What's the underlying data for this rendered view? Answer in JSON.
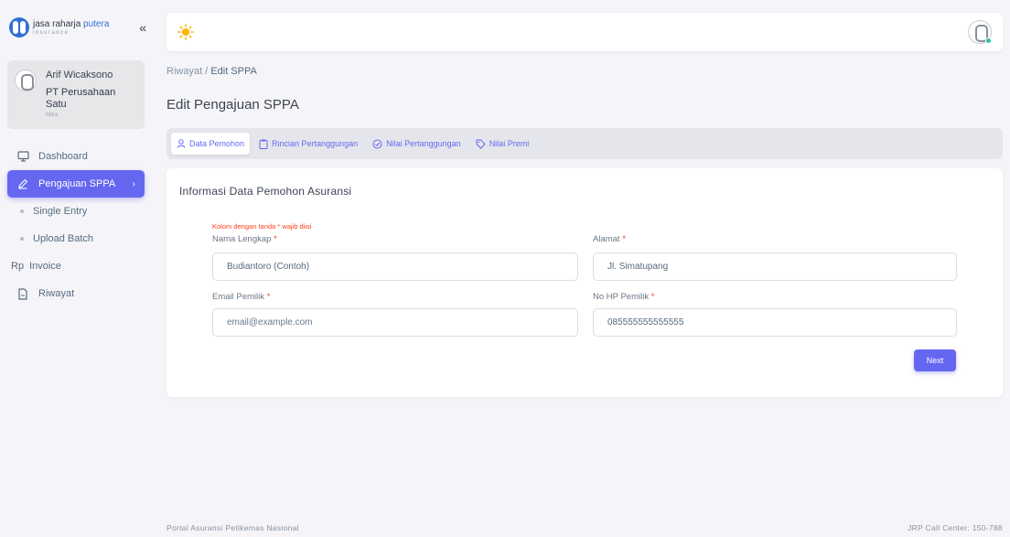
{
  "brand": {
    "name_part1": "jasa raharja ",
    "name_part2": "putera",
    "sub": "insurance"
  },
  "user": {
    "name": "Arif Wicaksono",
    "company": "PT Perusahaan Satu",
    "role": "Mitra"
  },
  "sidebar": {
    "items": [
      {
        "label": "Dashboard",
        "icon": "monitor-icon"
      },
      {
        "label": "Pengajuan SPPA",
        "icon": "pencil-icon",
        "active": true
      },
      {
        "label": "Single Entry",
        "sub": true
      },
      {
        "label": "Upload Batch",
        "sub": true
      },
      {
        "label": "Invoice",
        "icon_text": "Rp"
      },
      {
        "label": "Riwayat",
        "icon": "document-icon"
      }
    ]
  },
  "breadcrumb": {
    "parent": "Riwayat",
    "separator": " / ",
    "current": "Edit SPPA"
  },
  "page": {
    "title": "Edit Pengajuan SPPA"
  },
  "tabs": [
    {
      "label": "Data Pemohon",
      "icon": "user-icon",
      "active": true
    },
    {
      "label": "Rincian Pertanggungan",
      "icon": "clipboard-icon"
    },
    {
      "label": "Nilai Pertanggungan",
      "icon": "check-circle-icon"
    },
    {
      "label": "Nilai Premi",
      "icon": "tag-icon"
    }
  ],
  "form": {
    "title": "Informasi Data Pemohon Asuransi",
    "required_note": "Kolom dengan tanda * wajib diisi",
    "fields": {
      "nama": {
        "label": "Nama Lengkap",
        "value": "Budiantoro (Contoh)"
      },
      "alamat": {
        "label": "Alamat",
        "value": "Jl. Simatupang"
      },
      "email": {
        "label": "Email Pemilik",
        "placeholder": "email@example.com"
      },
      "hp": {
        "label": "No HP Pemilik",
        "value": "085555555555555"
      }
    },
    "next_label": "Next"
  },
  "footer": {
    "left": "Portal Asuransi Petikemas Nasional",
    "right": "JRP Call Center: 150-788"
  },
  "colors": {
    "primary": "#6567f0",
    "required": "#ff3e1d",
    "online": "#2cc3a5",
    "sun": "#ffb400"
  }
}
